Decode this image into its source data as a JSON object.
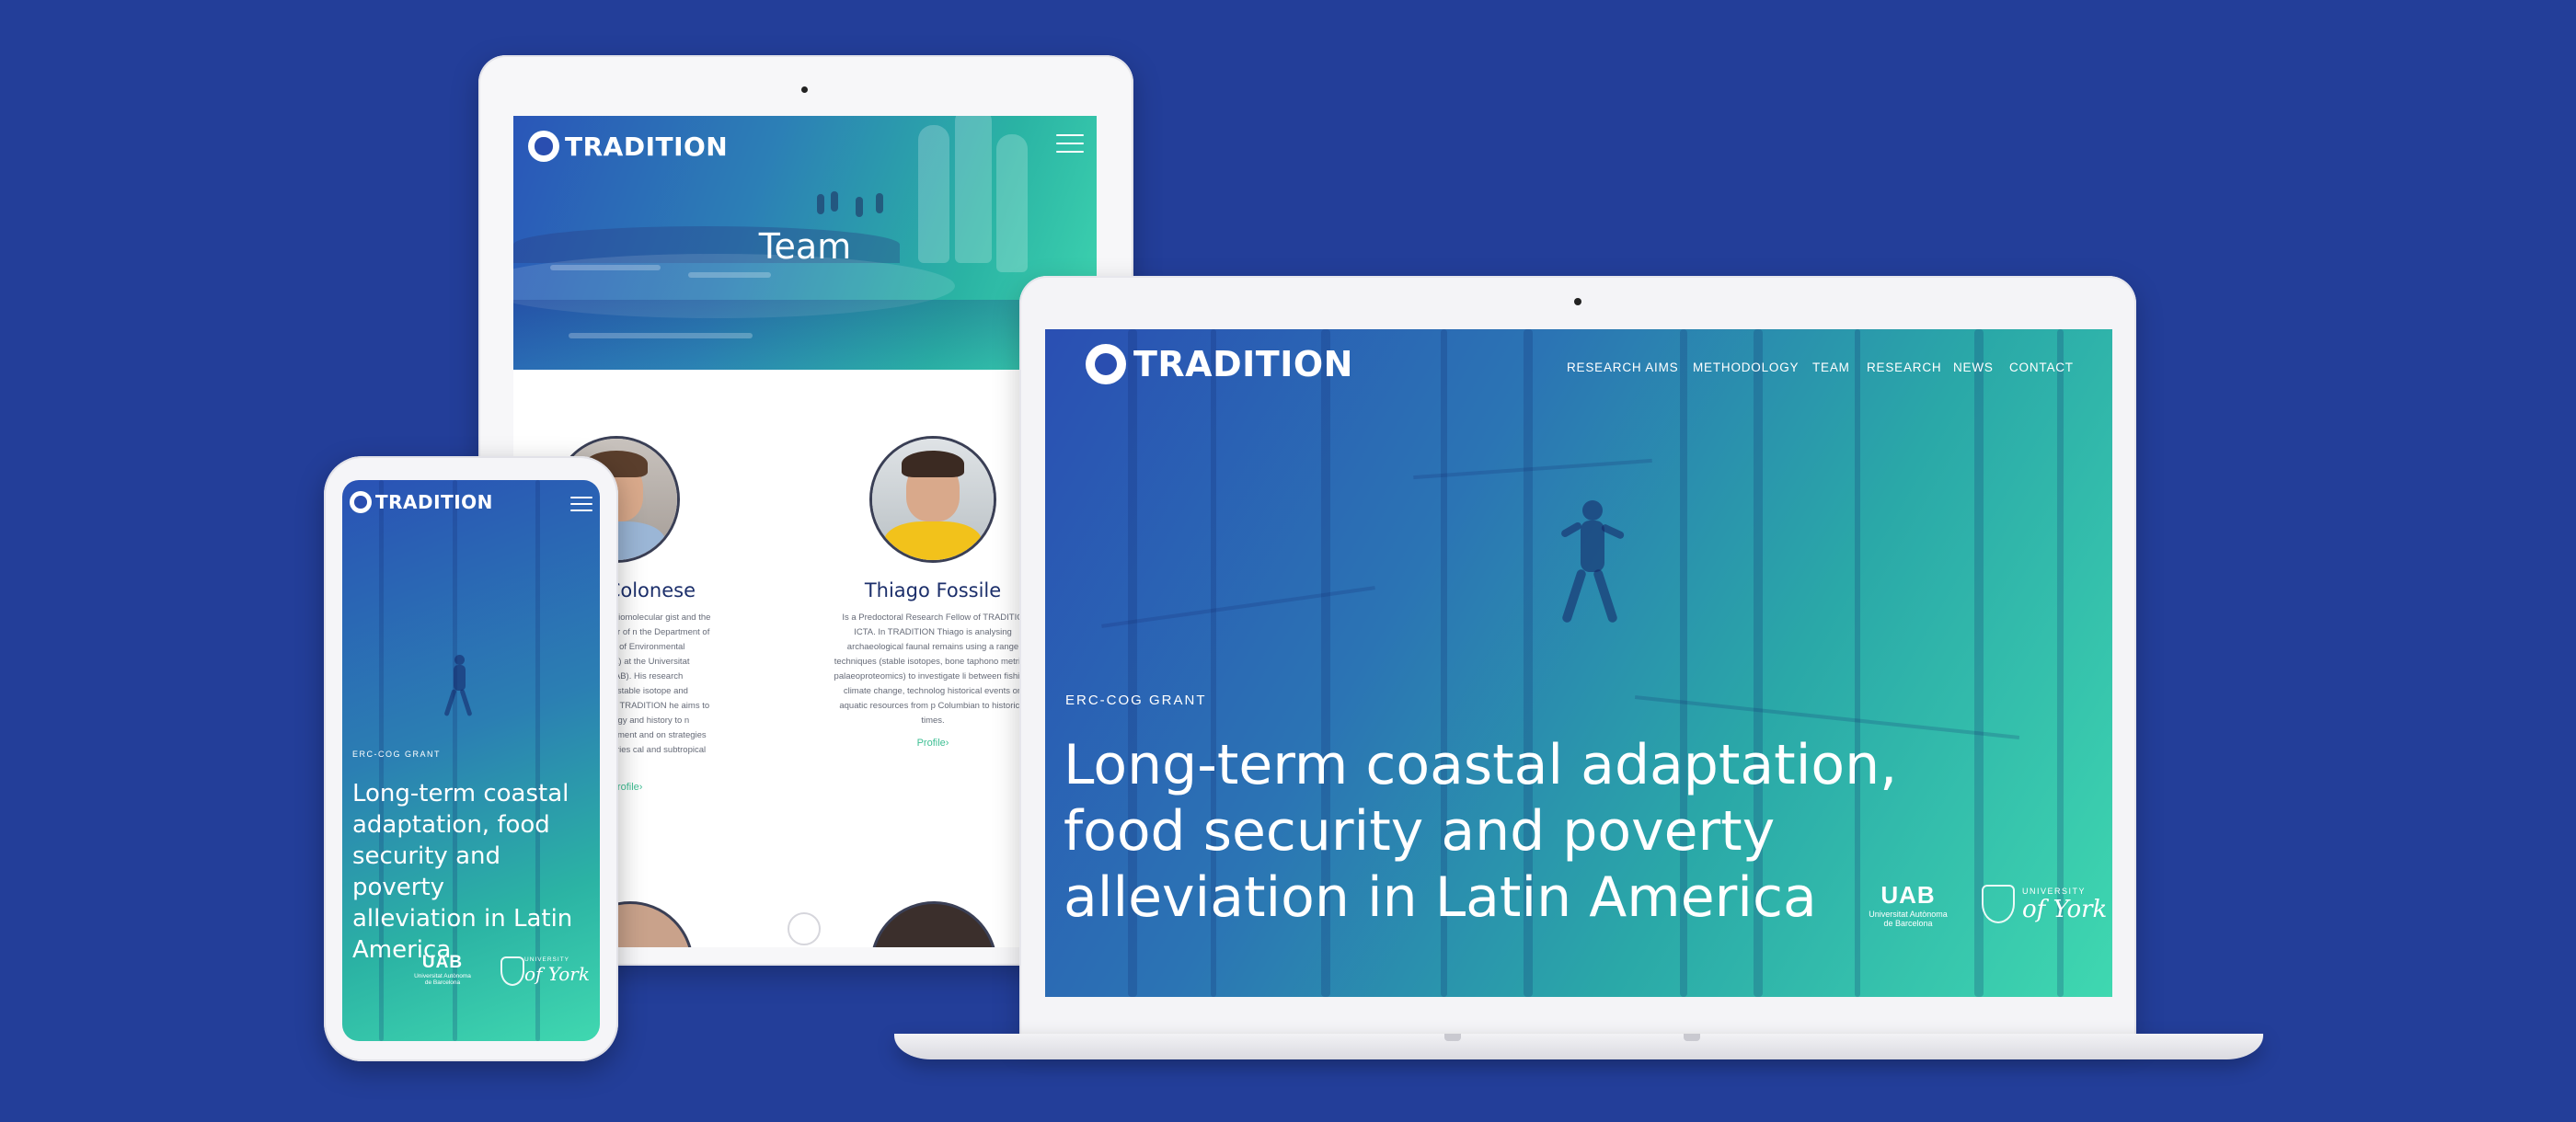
{
  "brand": {
    "name": "TRADITION"
  },
  "tablet": {
    "page_title": "Team",
    "members": [
      {
        "name": "dre Carlo Colonese",
        "bio": "environmental and biomolecular gist and the Principal Investigator of n the Department of Prehistory and titute of Environmental Science and y (ICTA) at the Universitat Autònoma elona (UAB). His research involves ology, tight stable isotope and organic alyses. With TRADITION he aims to otential of archaeology and history to n current-day management and on strategies for small-scale fisheries cal and subtropical South America.",
        "link": "Profile›"
      },
      {
        "name": "Thiago Fossile",
        "bio": "Is a Predoctoral Research Fellow of TRADITIO ICTA. In TRADITION Thiago is analysing archaeological faunal remains using a range techniques (stable isotopes, bone taphono metrics, palaeoproteomics) to investigate li between fishing, climate change, technolog historical events on aquatic resources from p Columbian to historical times.",
        "link": "Profile›"
      }
    ]
  },
  "laptop": {
    "nav": [
      "RESEARCH AIMS",
      "METHODOLOGY",
      "TEAM",
      "RESEARCH",
      "NEWS",
      "CONTACT"
    ],
    "eyebrow": "ERC-COG GRANT",
    "headline_lines": [
      "Long-term coastal adaptation,",
      "food security and poverty",
      "alleviation in Latin America"
    ]
  },
  "phone": {
    "eyebrow": "ERC-COG GRANT",
    "headline_lines": [
      "Long-term coastal",
      "adaptation, food",
      "security and poverty",
      "alleviation in Latin",
      "America"
    ]
  },
  "partners": {
    "uab_mark": "UAB",
    "uab_line1": "Universitat Autònoma",
    "uab_line2": "de Barcelona",
    "york_small": "UNIVERSITY",
    "york_big": "of York"
  },
  "colors": {
    "background": "#233e99",
    "accent_green": "#3fbf94",
    "gradient_start": "#2a4fb3",
    "gradient_end": "#3fd8b0"
  }
}
